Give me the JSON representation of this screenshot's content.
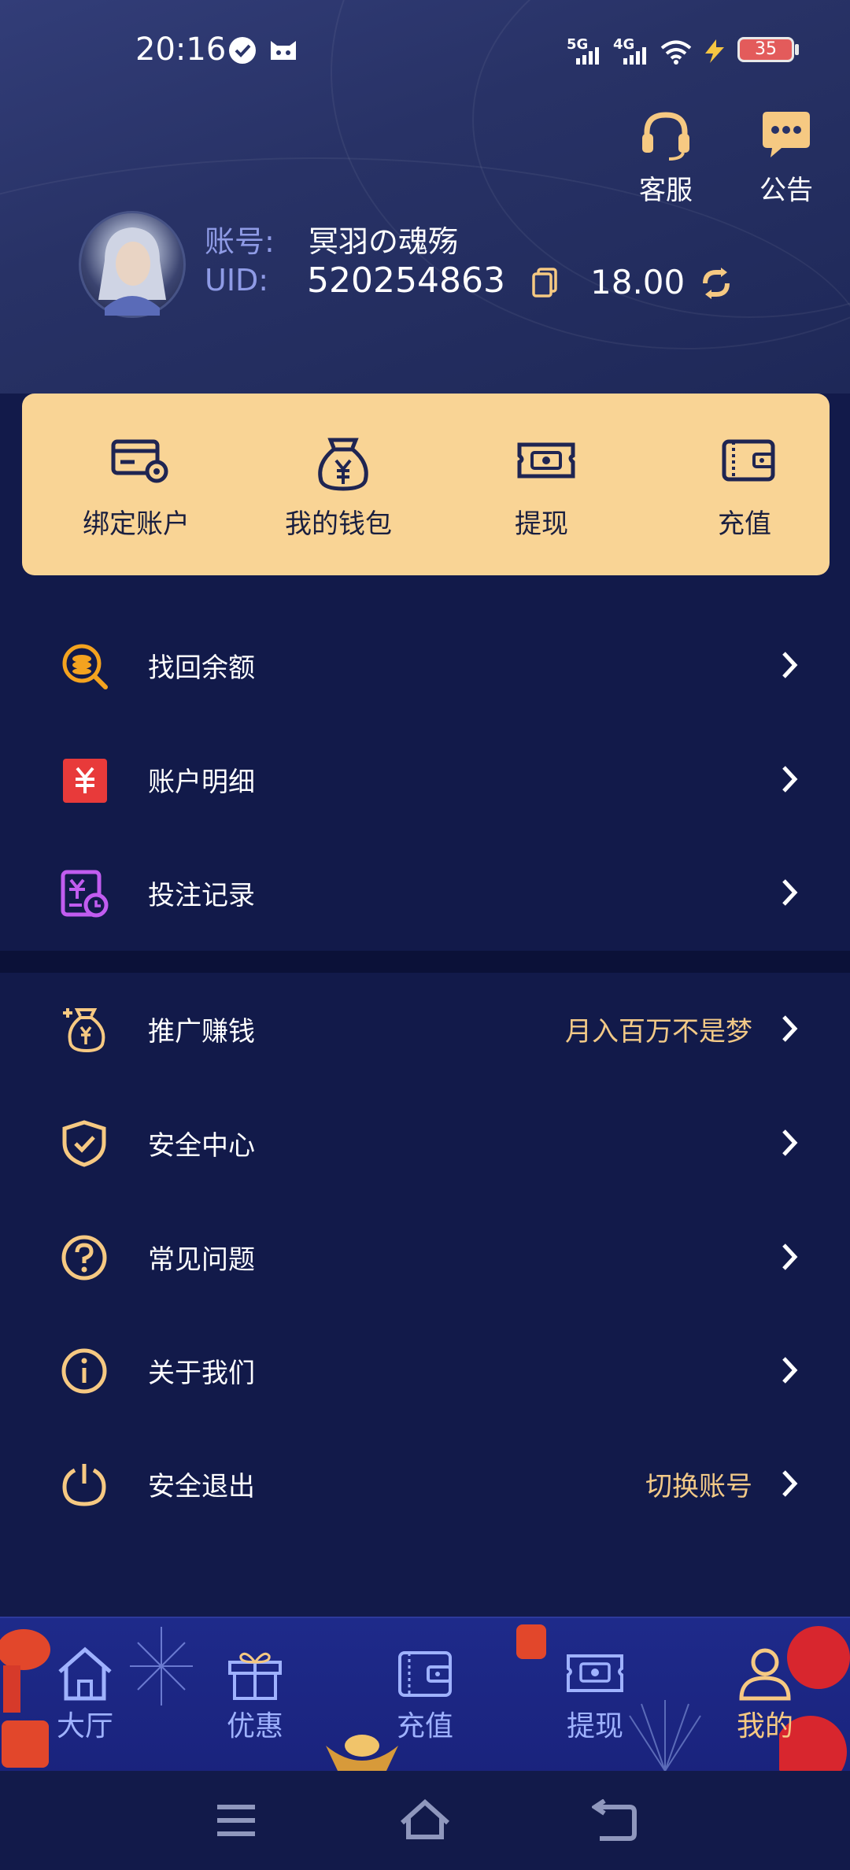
{
  "status_bar": {
    "time": "20:16",
    "net1": "5G",
    "net2": "4G",
    "battery": "35"
  },
  "header": {
    "service_label": "客服",
    "notice_label": "公告",
    "account_label": "账号:",
    "account_name": "冥羽の魂殇",
    "uid_label": "UID:",
    "uid_value": "520254863",
    "balance": "18.00"
  },
  "quick_actions": [
    {
      "label": "绑定账户",
      "icon": "card-settings-icon"
    },
    {
      "label": "我的钱包",
      "icon": "money-bag-icon"
    },
    {
      "label": "提现",
      "icon": "cash-ticket-icon"
    },
    {
      "label": "充值",
      "icon": "wallet-icon"
    }
  ],
  "menu_group1": [
    {
      "label": "找回余额",
      "icon": "coin-search-icon",
      "extra": ""
    },
    {
      "label": "账户明细",
      "icon": "yen-ledger-icon",
      "extra": ""
    },
    {
      "label": "投注记录",
      "icon": "bet-record-icon",
      "extra": ""
    }
  ],
  "menu_group2": [
    {
      "label": "推广赚钱",
      "icon": "promo-money-icon",
      "extra": "月入百万不是梦"
    },
    {
      "label": "安全中心",
      "icon": "shield-check-icon",
      "extra": ""
    },
    {
      "label": "常见问题",
      "icon": "question-icon",
      "extra": ""
    },
    {
      "label": "关于我们",
      "icon": "info-icon",
      "extra": ""
    },
    {
      "label": "安全退出",
      "icon": "power-icon",
      "extra": "切换账号"
    }
  ],
  "tabs": [
    {
      "label": "大厅",
      "icon": "home-icon",
      "active": false
    },
    {
      "label": "优惠",
      "icon": "gift-icon",
      "active": false
    },
    {
      "label": "充值",
      "icon": "wallet-icon",
      "active": false
    },
    {
      "label": "提现",
      "icon": "cash-ticket-icon",
      "active": false
    },
    {
      "label": "我的",
      "icon": "user-icon",
      "active": true
    }
  ],
  "colors": {
    "accent_gold": "#f6c982",
    "card_bg": "#f9d495",
    "page_bg": "#121a4a",
    "tab_bg": "#1e2a8a"
  }
}
